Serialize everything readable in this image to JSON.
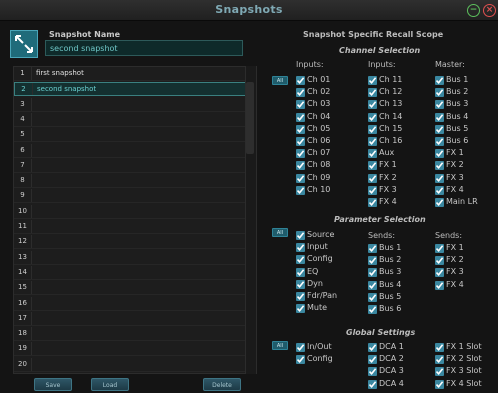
{
  "window": {
    "title": "Snapshots"
  },
  "snapshot": {
    "name_label": "Snapshot Name",
    "name_value": "second snapshot"
  },
  "list": {
    "rows": [
      {
        "num": "1",
        "name": "first snapshot"
      },
      {
        "num": "2",
        "name": "second snapshot"
      },
      {
        "num": "3",
        "name": ""
      },
      {
        "num": "4",
        "name": ""
      },
      {
        "num": "5",
        "name": ""
      },
      {
        "num": "6",
        "name": ""
      },
      {
        "num": "7",
        "name": ""
      },
      {
        "num": "8",
        "name": ""
      },
      {
        "num": "9",
        "name": ""
      },
      {
        "num": "10",
        "name": ""
      },
      {
        "num": "11",
        "name": ""
      },
      {
        "num": "12",
        "name": ""
      },
      {
        "num": "13",
        "name": ""
      },
      {
        "num": "14",
        "name": ""
      },
      {
        "num": "15",
        "name": ""
      },
      {
        "num": "16",
        "name": ""
      },
      {
        "num": "17",
        "name": ""
      },
      {
        "num": "18",
        "name": ""
      },
      {
        "num": "19",
        "name": ""
      },
      {
        "num": "20",
        "name": ""
      }
    ],
    "selected_index": 1
  },
  "buttons": {
    "save": "Save",
    "load": "Load",
    "delete": "Delete"
  },
  "scope": {
    "title": "Snapshot Specific Recall Scope",
    "all_label": "All",
    "channel": {
      "title": "Channel Selection",
      "col_headers": [
        "Inputs:",
        "Inputs:",
        "Master:"
      ],
      "col1": [
        "Ch 01",
        "Ch 02",
        "Ch 03",
        "Ch 04",
        "Ch 05",
        "Ch 06",
        "Ch 07",
        "Ch 08",
        "Ch 09",
        "Ch 10"
      ],
      "col2": [
        "Ch 11",
        "Ch 12",
        "Ch 13",
        "Ch 14",
        "Ch 15",
        "Ch 16",
        "Aux",
        "FX 1",
        "FX 2",
        "FX 3",
        "FX 4"
      ],
      "col3": [
        "Bus 1",
        "Bus 2",
        "Bus 3",
        "Bus 4",
        "Bus 5",
        "Bus 6",
        "FX 1",
        "FX 2",
        "FX 3",
        "FX 4",
        "Main LR"
      ]
    },
    "parameter": {
      "title": "Parameter Selection",
      "col_headers": [
        "",
        "Sends:",
        "Sends:"
      ],
      "col1": [
        "Source",
        "Input",
        "Config",
        "EQ",
        "Dyn",
        "Fdr/Pan",
        "Mute"
      ],
      "col2": [
        "Bus 1",
        "Bus 2",
        "Bus 3",
        "Bus 4",
        "Bus 5",
        "Bus 6"
      ],
      "col3": [
        "FX 1",
        "FX 2",
        "FX 3",
        "FX 4"
      ]
    },
    "global": {
      "title": "Global Settings",
      "col1": [
        "In/Out",
        "Config"
      ],
      "col2": [
        "DCA 1",
        "DCA 2",
        "DCA 3",
        "DCA 4"
      ],
      "col3": [
        "FX 1 Slot",
        "FX 2 Slot",
        "FX 3 Slot",
        "FX 4 Slot"
      ]
    }
  }
}
